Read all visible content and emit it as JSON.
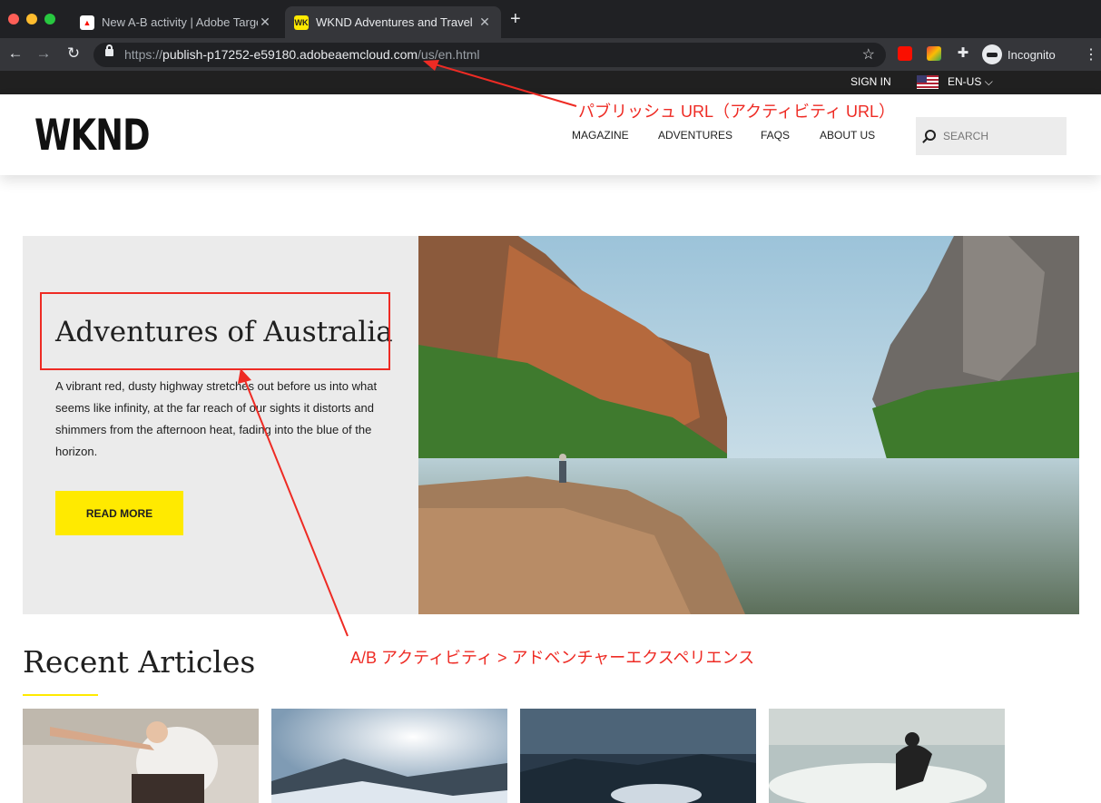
{
  "browser": {
    "tabs": [
      {
        "title": "New A-B activity | Adobe Targe",
        "favicon": "adobe-icon",
        "active": false
      },
      {
        "title": "WKND Adventures and Travel",
        "favicon": "wknd-icon",
        "active": true
      }
    ],
    "url_scheme": "https://",
    "url_host": "publish-p17252-e59180.adobeaemcloud.com",
    "url_path": "/us/en.html",
    "profile_label": "Incognito"
  },
  "site": {
    "topbar": {
      "sign_in": "SIGN IN",
      "language": "EN-US"
    },
    "logo": "WKND",
    "nav": [
      "MAGAZINE",
      "ADVENTURES",
      "FAQS",
      "ABOUT US"
    ],
    "search_placeholder": "SEARCH",
    "hero": {
      "title": "Adventures of Australia",
      "text": "A vibrant red, dusty highway stretches out before us into what seems like infinity, at the far reach of our sights it distorts and shimmers from the afternoon heat, fading into the blue of the horizon.",
      "button": "READ MORE"
    },
    "recent_title": "Recent Articles"
  },
  "annotations": {
    "url_note": "パブリッシュ URL（アクティビティ URL）",
    "ab_note": "A/B アクティビティ > アドベンチャーエクスペリエンス"
  },
  "colors": {
    "accent_yellow": "#ffea00",
    "annotation_red": "#ee2b24",
    "browser_dark": "#202124"
  }
}
